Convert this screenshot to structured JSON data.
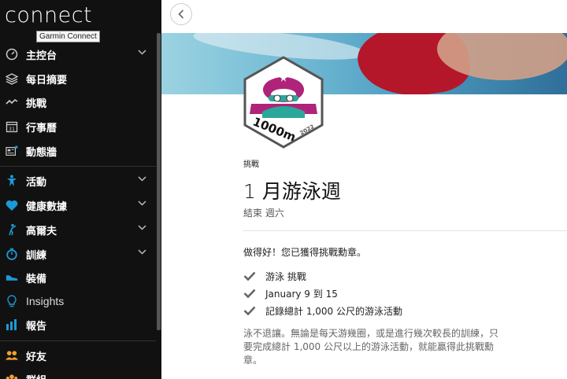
{
  "app": {
    "logo": "connect",
    "tooltip": "Garmin Connect"
  },
  "sidebar": {
    "items": [
      {
        "label": "主控台",
        "icon": "gauge-icon",
        "chevron": true
      },
      {
        "label": "每日摘要",
        "icon": "layers-icon",
        "chevron": false
      },
      {
        "label": "挑戰",
        "icon": "pulse-icon",
        "chevron": false
      },
      {
        "label": "行事曆",
        "icon": "calendar-icon",
        "chevron": false,
        "icon_text": "31"
      },
      {
        "label": "動態牆",
        "icon": "newsfeed-icon",
        "chevron": false
      },
      {
        "label": "活動",
        "icon": "running-person-icon",
        "chevron": true
      },
      {
        "label": "健康數據",
        "icon": "heart-icon",
        "chevron": true
      },
      {
        "label": "高爾夫",
        "icon": "golfer-icon",
        "chevron": true
      },
      {
        "label": "訓練",
        "icon": "stopwatch-icon",
        "chevron": true
      },
      {
        "label": "裝備",
        "icon": "shoe-icon",
        "chevron": false
      },
      {
        "label": "Insights",
        "icon": "lightbulb-icon",
        "chevron": false
      },
      {
        "label": "報告",
        "icon": "bar-chart-icon",
        "chevron": false
      },
      {
        "label": "好友",
        "icon": "friends-icon",
        "chevron": false
      },
      {
        "label": "群組",
        "icon": "group-icon",
        "chevron": false
      }
    ]
  },
  "challenge": {
    "badge_text": "1000m",
    "badge_year": "2022",
    "category": "挑戰",
    "title": "1 月游泳週",
    "status": "結束 週六",
    "congrats": "做得好！您已獲得挑戰勳章。",
    "checklist": [
      "游泳 挑戰",
      "January 9 到 15",
      "記錄總計 1,000 公尺的游泳活動"
    ],
    "description": "泳不退讓。無論是每天游幾圈，或是進行幾次較長的訓練，只要完成總計 1,000 公尺以上的游泳活動，就能贏得此挑戰勳章。"
  },
  "colors": {
    "sidebar_bg": "#111111",
    "accent_blue": "#1a9bd7",
    "accent_orange": "#f0a030",
    "badge_magenta": "#b0237a",
    "badge_teal": "#2aa89a"
  }
}
